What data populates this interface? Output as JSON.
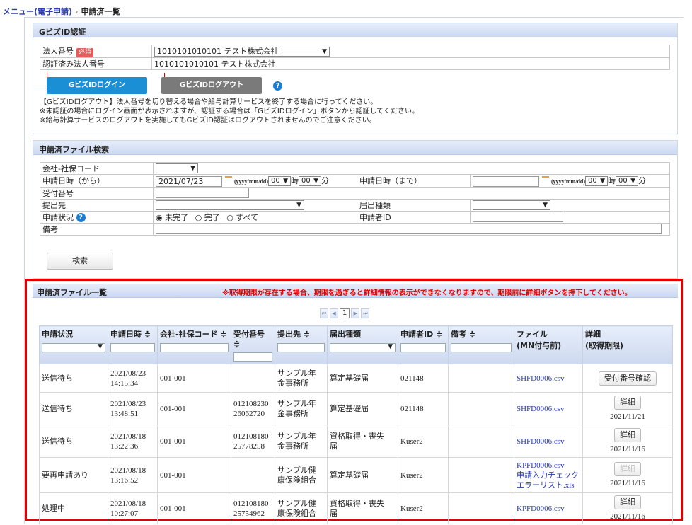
{
  "breadcrumb": {
    "menu": "メニュー(電子申請)",
    "current": "申請済一覧"
  },
  "gbiz": {
    "title": "GビズID認証",
    "corp_label": "法人番号",
    "required": "必須",
    "corp_value": "1010101010101 テスト株式会社",
    "auth_label": "認証済み法人番号",
    "auth_value": "1010101010101 テスト株式会社",
    "login": "GビズIDログイン",
    "logout": "GビズIDログアウト",
    "notes": [
      "【GビズIDログアウト】法人番号を切り替える場合や給与計算サービスを終了する場合に行ってください。",
      "※未認証の場合にログイン画面が表示されますが、認証する場合は「GビズIDログイン」ボタンから認証してください。",
      "※給与計算サービスのログアウトを実施してもGビズID認証はログアウトされませんのでご注意ください。"
    ]
  },
  "search": {
    "title": "申請済ファイル検索",
    "company_code": "会社-社保コード",
    "from_label": "申請日時（から）",
    "from_date": "2021/07/23",
    "to_label": "申請日時（まで）",
    "date_hint": "(yyyy/mm/dd)",
    "hour": "00",
    "minute": "00",
    "hour_unit": "時",
    "minute_unit": "分",
    "receipt": "受付番号",
    "dest": "提出先",
    "kind": "届出種類",
    "status": "申請状況",
    "applicant": "申請者ID",
    "notes_label": "備考",
    "radio_incomplete": "未完了",
    "radio_complete": "完了",
    "radio_all": "すべて",
    "button": "検索"
  },
  "list": {
    "title": "申請済ファイル一覧",
    "warning": "※取得期限が存在する場合、期限を過ぎると詳細情報の表示ができなくなりますので、期限前に詳細ボタンを押下してください。",
    "page": "1",
    "headers": {
      "status": "申請状況",
      "date": "申請日時 ≑",
      "code": "会社-社保コード ≑",
      "receipt": "受付番号 ≑",
      "dest": "提出先 ≑",
      "kind": "届出種類",
      "applicant": "申請者ID ≑",
      "note": "備考 ≑",
      "file1": "ファイル",
      "file2": "(MN付与前)",
      "detail1": "詳細",
      "detail2": "(取得期限)"
    },
    "rows": [
      {
        "status": "送信待ち",
        "d1": "2021/08/23",
        "d2": "14:15:34",
        "code": "001-001",
        "r1": "",
        "r2": "",
        "dest1": "サンプル年",
        "dest2": "金事務所",
        "kind1": "算定基礎届",
        "kind2": "",
        "applicant": "021148",
        "file1": "SHFD0006.csv",
        "file2": "",
        "file3": "",
        "btn": "受付番号確認",
        "deadline": ""
      },
      {
        "status": "送信待ち",
        "d1": "2021/08/23",
        "d2": "13:48:51",
        "code": "001-001",
        "r1": "012108230",
        "r2": "26062720",
        "dest1": "サンプル年",
        "dest2": "金事務所",
        "kind1": "算定基礎届",
        "kind2": "",
        "applicant": "021148",
        "file1": "SHFD0006.csv",
        "file2": "",
        "file3": "",
        "btn": "詳細",
        "deadline": "2021/11/21"
      },
      {
        "status": "送信待ち",
        "d1": "2021/08/18",
        "d2": "13:22:36",
        "code": "001-001",
        "r1": "012108180",
        "r2": "25778258",
        "dest1": "サンプル年",
        "dest2": "金事務所",
        "kind1": "資格取得・喪失",
        "kind2": "届",
        "applicant": "Kuser2",
        "file1": "SHFD0006.csv",
        "file2": "",
        "file3": "",
        "btn": "詳細",
        "deadline": "2021/11/16"
      },
      {
        "status": "要再申請あり",
        "d1": "2021/08/18",
        "d2": "13:16:52",
        "code": "001-001",
        "r1": "",
        "r2": "",
        "dest1": "サンプル健",
        "dest2": "康保険組合",
        "kind1": "算定基礎届",
        "kind2": "",
        "applicant": "Kuser2",
        "file1": "KPFD0006.csv",
        "file2": "申請入力チェック",
        "file3": "エラーリスト.xls",
        "btn": "詳細",
        "deadline": "2021/11/16"
      },
      {
        "status": "処理中",
        "d1": "2021/08/18",
        "d2": "10:27:07",
        "code": "001-001",
        "r1": "012108180",
        "r2": "25754962",
        "dest1": "サンプル健",
        "dest2": "康保険組合",
        "kind1": "資格取得・喪失",
        "kind2": "届",
        "applicant": "Kuser2",
        "file1": "KPFD0006.csv",
        "file2": "",
        "file3": "",
        "btn": "詳細",
        "deadline": "2021/11/16"
      }
    ]
  },
  "colors": {
    "accent": "#1b8fd6",
    "frame": "#e00000",
    "warning": "#e00000",
    "link": "#2a3cb4"
  }
}
